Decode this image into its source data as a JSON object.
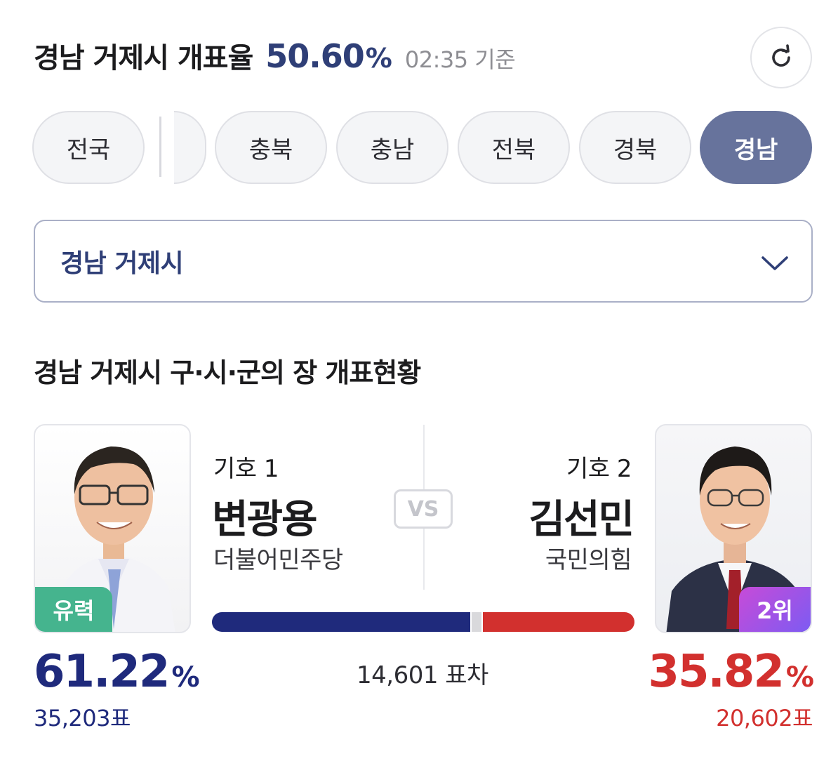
{
  "header": {
    "title": "경남 거제시 개표율",
    "rate": "50.60",
    "rate_unit": "%",
    "time": "02:35 기준",
    "refresh_icon": "refresh-icon"
  },
  "regions": {
    "items": [
      "전국",
      "충북",
      "충남",
      "전북",
      "경북",
      "경남"
    ],
    "selected": "경남"
  },
  "dropdown": {
    "value": "경남 거제시",
    "icon": "chevron-down-icon"
  },
  "section": {
    "title": "경남 거제시 구·시·군의 장 개표현황"
  },
  "vs_label": "VS",
  "candidates": [
    {
      "number": "기호 1",
      "name": "변광용",
      "party": "더불어민주당",
      "badge": "유력",
      "percent": "61.22",
      "percent_unit": "%",
      "votes": "35,203표",
      "color": "#1f2a7c"
    },
    {
      "number": "기호 2",
      "name": "김선민",
      "party": "국민의힘",
      "badge": "2위",
      "percent": "35.82",
      "percent_unit": "%",
      "votes": "20,602표",
      "color": "#d2302e"
    }
  ],
  "vote_bar": {
    "left_share": 0.6122,
    "right_share": 0.3582
  },
  "difference": "14,601 표차",
  "colors": {
    "accent": "#2f3f77",
    "active_chip": "#67739c",
    "lead_badge": "#45b48e"
  }
}
